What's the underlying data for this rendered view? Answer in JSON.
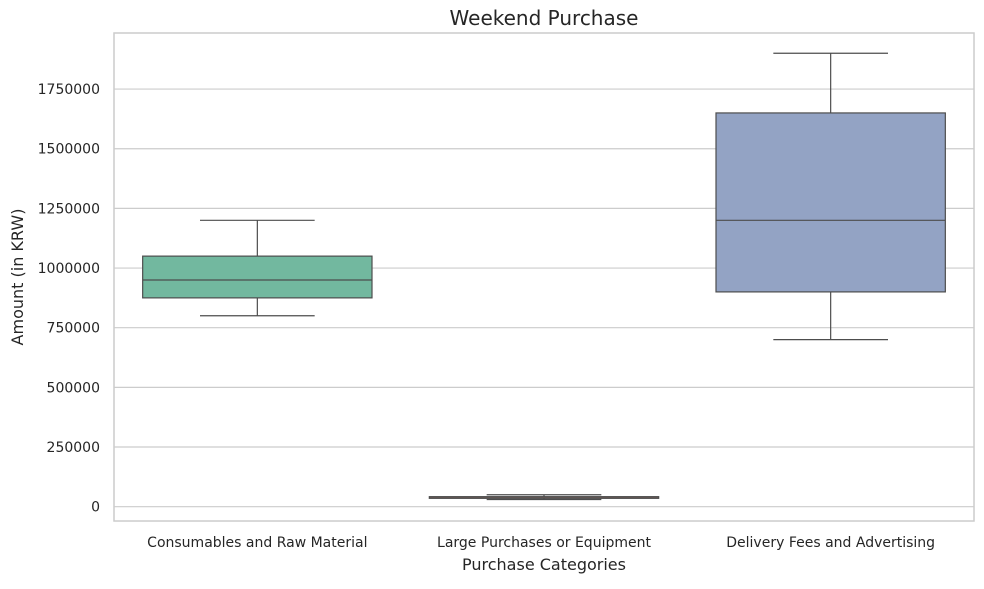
{
  "chart_data": {
    "type": "box",
    "title": "Weekend Purchase",
    "xlabel": "Purchase Categories",
    "ylabel": "Amount (in KRW)",
    "ylim": [
      -60000,
      1985000
    ],
    "yticks": [
      0,
      250000,
      500000,
      750000,
      1000000,
      1250000,
      1500000,
      1750000
    ],
    "ytick_labels": [
      "0",
      "250000",
      "500000",
      "750000",
      "1000000",
      "1250000",
      "1500000",
      "1750000"
    ],
    "grid": true,
    "categories": [
      "Consumables and Raw Material",
      "Large Purchases or Equipment",
      "Delivery Fees and Advertising"
    ],
    "boxes": [
      {
        "category": "Consumables and Raw Material",
        "min": 800000,
        "q1": 875000,
        "median": 950000,
        "q3": 1050000,
        "max": 1200000,
        "color": "#72b89f"
      },
      {
        "category": "Large Purchases or Equipment",
        "min": 30000,
        "q1": 35000,
        "median": 40000,
        "q3": 42000,
        "max": 50000,
        "color": "#f09a78"
      },
      {
        "category": "Delivery Fees and Advertising",
        "min": 700000,
        "q1": 900000,
        "median": 1200000,
        "q3": 1650000,
        "max": 1900000,
        "color": "#93a3c4"
      }
    ]
  }
}
